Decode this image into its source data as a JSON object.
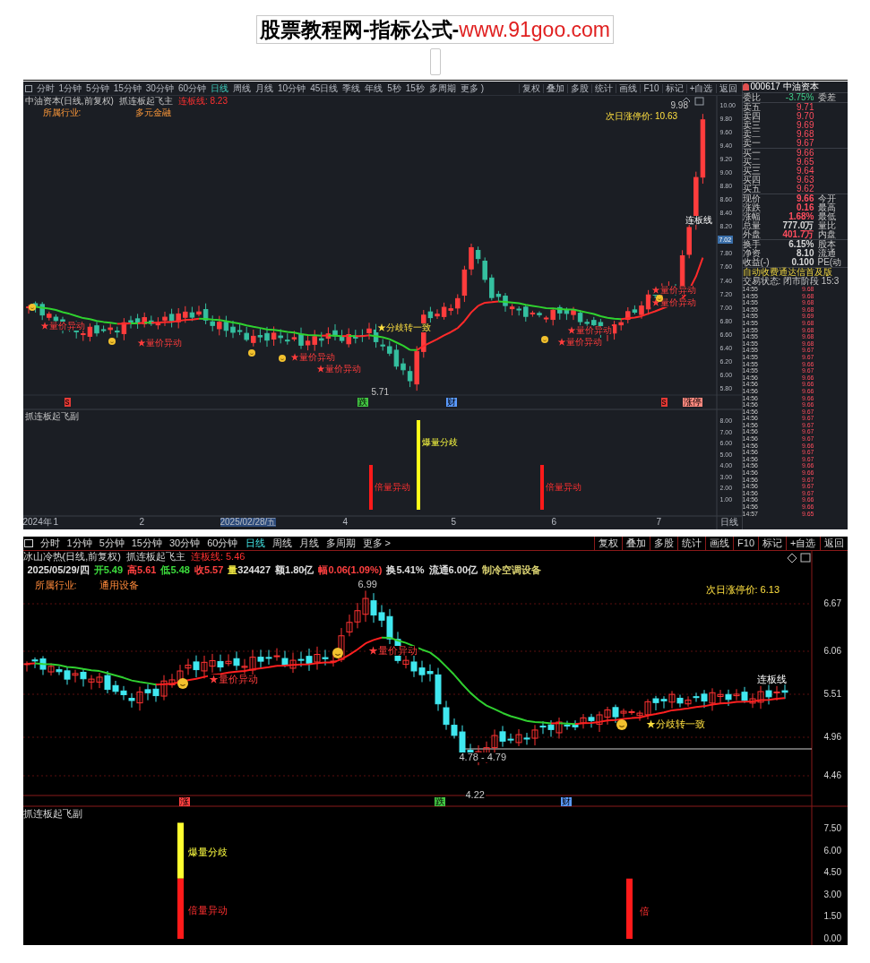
{
  "header": {
    "title": "股票教程网-指标公式-",
    "url": "www.91goo.com"
  },
  "chart_1": {
    "periods": [
      {
        "label": "分时",
        "selected": false
      },
      {
        "label": "1分钟",
        "selected": false
      },
      {
        "label": "5分钟",
        "selected": false
      },
      {
        "label": "15分钟",
        "selected": false
      },
      {
        "label": "30分钟",
        "selected": false
      },
      {
        "label": "60分钟",
        "selected": false
      },
      {
        "label": "日线",
        "selected": true
      },
      {
        "label": "周线",
        "selected": false
      },
      {
        "label": "月线",
        "selected": false
      },
      {
        "label": "10分钟",
        "selected": false
      },
      {
        "label": "45日线",
        "selected": false
      },
      {
        "label": "季线",
        "selected": false
      },
      {
        "label": "年线",
        "selected": false
      },
      {
        "label": "5秒",
        "selected": false
      },
      {
        "label": "15秒",
        "selected": false
      },
      {
        "label": "多周期",
        "selected": false
      },
      {
        "label": "更多 )",
        "selected": false
      }
    ],
    "actions": [
      "复权",
      "叠加",
      "多股",
      "统计",
      "画线",
      "F10",
      "标记",
      "+自选",
      "返回"
    ],
    "title": "中油资本(日线,前复权)",
    "indicator": "抓连板起飞主",
    "indicator_value": "连板线: 8.23",
    "industry_label": "所属行业:",
    "industry": "多元金融",
    "limit_price": "次日涨停价: 10.63",
    "price_ticks": [
      "10.00",
      "9.80",
      "9.60",
      "9.40",
      "9.20",
      "9.00",
      "8.80",
      "8.60",
      "8.40",
      "8.20",
      "7.80",
      "7.60",
      "7.40",
      "7.20",
      "7.00",
      "6.80",
      "6.60",
      "6.40",
      "6.20",
      "6.00",
      "5.80"
    ],
    "current_price": "7.02",
    "annotations": [
      {
        "kind": "price",
        "text": "9.98"
      },
      {
        "kind": "line",
        "text": "连板线"
      },
      {
        "kind": "signal",
        "text": "★量价异动"
      },
      {
        "kind": "signal",
        "text": "★量价异动"
      },
      {
        "kind": "signal",
        "text": "★量价异动"
      },
      {
        "kind": "signal",
        "text": "★量价异动"
      },
      {
        "kind": "signal",
        "text": "★量价异动"
      },
      {
        "kind": "signal",
        "text": "★量价异动"
      },
      {
        "kind": "signal",
        "text": "★量价异动"
      },
      {
        "kind": "signal",
        "text": "★量价异动"
      },
      {
        "kind": "turn",
        "text": "★分歧转一致"
      },
      {
        "kind": "price",
        "text": "5.71"
      }
    ],
    "markers": [
      {
        "text": "s",
        "color": "#e53935"
      },
      {
        "text": "跌",
        "color": "#43c743"
      },
      {
        "text": "财",
        "color": "#5b9bff"
      },
      {
        "text": "s",
        "color": "#e53935"
      },
      {
        "text": "涨停",
        "color": "#ff8a80"
      }
    ],
    "sub_indicator": "抓连板起飞副",
    "sub_ticks": [
      "8.00",
      "7.00",
      "6.00",
      "5.00",
      "4.00",
      "3.00",
      "2.00",
      "1.00"
    ],
    "sub_labels": [
      "倍量异动",
      "爆量分歧",
      "倍量异动"
    ],
    "dates": [
      "2024年",
      "1",
      "2",
      "2025/02/28/五",
      "4",
      "5",
      "6",
      "7"
    ],
    "period_label": "日线",
    "quote": {
      "stock": "000617 中油资本",
      "ratio": {
        "label": "委比",
        "value": "-3.75%",
        "tail": "委差"
      },
      "asks": [
        {
          "label": "卖五",
          "price": "9.71"
        },
        {
          "label": "卖四",
          "price": "9.70"
        },
        {
          "label": "卖三",
          "price": "9.69"
        },
        {
          "label": "卖二",
          "price": "9.68"
        },
        {
          "label": "卖一",
          "price": "9.67"
        }
      ],
      "bids": [
        {
          "label": "买一",
          "price": "9.66"
        },
        {
          "label": "买二",
          "price": "9.65"
        },
        {
          "label": "买三",
          "price": "9.64"
        },
        {
          "label": "买四",
          "price": "9.63"
        },
        {
          "label": "买五",
          "price": "9.62"
        }
      ],
      "stats": [
        {
          "label": "现价",
          "value": "9.66",
          "tail": "今开",
          "color": "#ff4d5e"
        },
        {
          "label": "涨跌",
          "value": "0.16",
          "tail": "最高",
          "color": "#ff4d5e"
        },
        {
          "label": "涨幅",
          "value": "1.68%",
          "tail": "最低",
          "color": "#ff4d5e"
        },
        {
          "label": "总量",
          "value": "777.0万",
          "tail": "量比",
          "color": "#d8d8d8"
        },
        {
          "label": "外盘",
          "value": "401.7万",
          "tail": "内盘",
          "color": "#ff4d5e"
        },
        {
          "label": "换手",
          "value": "6.15%",
          "tail": "股本",
          "color": "#d8d8d8"
        },
        {
          "label": "净资",
          "value": "8.10",
          "tail": "流通",
          "color": "#d8d8d8"
        },
        {
          "label": "收益(-)",
          "value": "0.100",
          "tail": "PE(动",
          "color": "#d8d8d8"
        }
      ],
      "notice": "自动收费通达信首及版",
      "status": "交易状态: 闭市阶段 15:3",
      "ticks": [
        {
          "time": "14:55",
          "price": "9.68"
        },
        {
          "time": "14:55",
          "price": "9.68"
        },
        {
          "time": "14:55",
          "price": "9.68"
        },
        {
          "time": "14:55",
          "price": "9.68"
        },
        {
          "time": "14:55",
          "price": "9.69"
        },
        {
          "time": "14:55",
          "price": "9.68"
        },
        {
          "time": "14:55",
          "price": "9.68"
        },
        {
          "time": "14:55",
          "price": "9.68"
        },
        {
          "time": "14:55",
          "price": "9.68"
        },
        {
          "time": "14:55",
          "price": "9.67"
        },
        {
          "time": "14:55",
          "price": "9.67"
        },
        {
          "time": "14:55",
          "price": "9.66"
        },
        {
          "time": "14:55",
          "price": "9.67"
        },
        {
          "time": "14:56",
          "price": "9.66"
        },
        {
          "time": "14:56",
          "price": "9.66"
        },
        {
          "time": "14:56",
          "price": "9.66"
        },
        {
          "time": "14:56",
          "price": "9.66"
        },
        {
          "time": "14:56",
          "price": "9.66"
        },
        {
          "time": "14:56",
          "price": "9.67"
        },
        {
          "time": "14:56",
          "price": "9.67"
        },
        {
          "time": "14:56",
          "price": "9.67"
        },
        {
          "time": "14:56",
          "price": "9.67"
        },
        {
          "time": "14:56",
          "price": "9.67"
        },
        {
          "time": "14:56",
          "price": "9.66"
        },
        {
          "time": "14:56",
          "price": "9.67"
        },
        {
          "time": "14:56",
          "price": "9.67"
        },
        {
          "time": "14:56",
          "price": "9.66"
        },
        {
          "time": "14:56",
          "price": "9.66"
        },
        {
          "time": "14:56",
          "price": "9.67"
        },
        {
          "time": "14:56",
          "price": "9.67"
        },
        {
          "time": "14:56",
          "price": "9.67"
        },
        {
          "time": "14:56",
          "price": "9.66"
        },
        {
          "time": "14:56",
          "price": "9.66"
        },
        {
          "time": "14:57",
          "price": "9.65"
        }
      ]
    }
  },
  "chart_2": {
    "periods": [
      {
        "label": "分时",
        "selected": false
      },
      {
        "label": "1分钟",
        "selected": false
      },
      {
        "label": "5分钟",
        "selected": false
      },
      {
        "label": "15分钟",
        "selected": false
      },
      {
        "label": "30分钟",
        "selected": false
      },
      {
        "label": "60分钟",
        "selected": false
      },
      {
        "label": "日线",
        "selected": true
      },
      {
        "label": "周线",
        "selected": false
      },
      {
        "label": "月线",
        "selected": false
      },
      {
        "label": "多周期",
        "selected": false
      },
      {
        "label": "更多 >",
        "selected": false
      }
    ],
    "actions": [
      "复权",
      "叠加",
      "多股",
      "统计",
      "画线",
      "F10",
      "标记",
      "+自选",
      "返回"
    ],
    "title": "冰山冷热(日线,前复权)",
    "indicator": "抓连板起飞主",
    "indicator_value": "连板线: 5.46",
    "quote_line": [
      {
        "kind": "label",
        "text": "2025/05/29/四",
        "color": "#e0e0e0"
      },
      {
        "kind": "label",
        "text": "开",
        "color": "#3cdc3c"
      },
      {
        "kind": "value",
        "text": "5.49",
        "color": "#3cdc3c"
      },
      {
        "kind": "label",
        "text": "高",
        "color": "#ff4040"
      },
      {
        "kind": "value",
        "text": "5.61",
        "color": "#ff4040"
      },
      {
        "kind": "label",
        "text": "低",
        "color": "#3cdc3c"
      },
      {
        "kind": "value",
        "text": "5.48",
        "color": "#3cdc3c"
      },
      {
        "kind": "label",
        "text": "收",
        "color": "#ff4040"
      },
      {
        "kind": "value",
        "text": "5.57",
        "color": "#ff4040"
      },
      {
        "kind": "label",
        "text": "量",
        "color": "#e8e040"
      },
      {
        "kind": "value",
        "text": "324427",
        "color": "#e0e0e0"
      },
      {
        "kind": "label",
        "text": "额",
        "color": "#e0e0e0"
      },
      {
        "kind": "value",
        "text": "1.80亿",
        "color": "#e0e0e0"
      },
      {
        "kind": "label",
        "text": "幅",
        "color": "#ff4040"
      },
      {
        "kind": "value",
        "text": "0.06(1.09%)",
        "color": "#ff4040"
      },
      {
        "kind": "label",
        "text": "换",
        "color": "#e0e0e0"
      },
      {
        "kind": "value",
        "text": "5.41%",
        "color": "#e0e0e0"
      },
      {
        "kind": "label",
        "text": "流通",
        "color": "#e0e0e0"
      },
      {
        "kind": "value",
        "text": "6.00亿",
        "color": "#e0e0e0"
      },
      {
        "kind": "label",
        "text": "制冷空调设备",
        "color": "#d8d070"
      }
    ],
    "industry_label": "所属行业:",
    "industry": "通用设备",
    "limit_price": "次日涨停价: 6.13",
    "price_ticks": [
      "6.67",
      "6.06",
      "5.51",
      "4.96",
      "4.46"
    ],
    "annotations": [
      {
        "kind": "price",
        "text": "6.99"
      },
      {
        "kind": "signal",
        "text": "★量价异动"
      },
      {
        "kind": "signal",
        "text": "★量价异动"
      },
      {
        "kind": "turn",
        "text": "★分歧转一致"
      },
      {
        "kind": "price",
        "text": "4.78 - 4.79"
      },
      {
        "kind": "price",
        "text": "4.22"
      },
      {
        "kind": "line",
        "text": "连板线"
      }
    ],
    "markers": [
      {
        "text": "涨",
        "color": "#ff4040"
      },
      {
        "text": "跌",
        "color": "#43c743"
      },
      {
        "text": "财",
        "color": "#5b9bff"
      }
    ],
    "sub_indicator": "抓连板起飞副",
    "sub_ticks": [
      "7.50",
      "6.00",
      "4.50",
      "3.00",
      "1.50",
      "0.00"
    ],
    "sub_labels": [
      "爆量分歧",
      "倍量异动",
      "倍"
    ]
  }
}
